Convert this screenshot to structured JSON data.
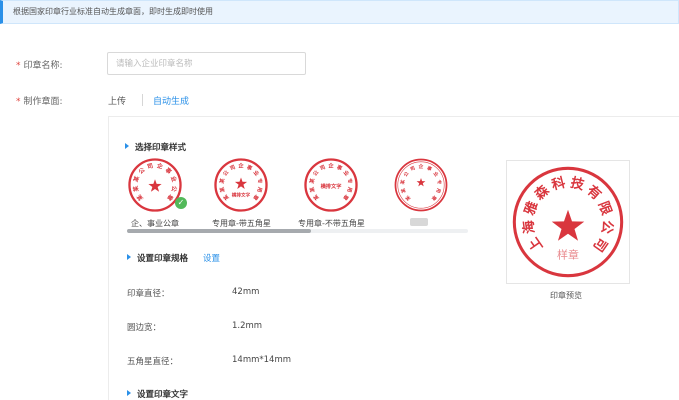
{
  "notice": {
    "text": "根据国家印章行业标准自动生成章面，即时生成即时使用"
  },
  "form": {
    "name_label": "印章名称:",
    "name_placeholder": "请输入企业印章名称",
    "make_label": "制作章面:",
    "required_mark": "*"
  },
  "mode_tabs": {
    "upload": "上传",
    "auto": "自动生成",
    "active": "auto"
  },
  "style_section": {
    "title": "选择印章样式",
    "styles": [
      {
        "label": "企、事业公章",
        "seal_text": "某某某公司企事业公章",
        "center_text": "",
        "selected": true
      },
      {
        "label": "专用章-带五角星",
        "seal_text": "某某某公司企事业专用章",
        "center_text": "横排文字",
        "selected": false
      },
      {
        "label": "专用章-不带五角星",
        "seal_text": "某某某公司企事业专用章",
        "center_text": "横排文字",
        "selected": false
      },
      {
        "label": "",
        "seal_text": "某某某公司企事业专用章",
        "center_text": "",
        "selected": false
      }
    ]
  },
  "spec_section": {
    "title": "设置印章规格",
    "settings_link": "设置",
    "rows": [
      {
        "label": "印章直径：",
        "value": "42mm"
      },
      {
        "label": "圆边宽：",
        "value": "1.2mm"
      },
      {
        "label": "五角星直径：",
        "value": "14mm*14mm"
      }
    ]
  },
  "text_section": {
    "title": "设置印章文字"
  },
  "preview": {
    "label": "印章预览",
    "seal_text": "上海雅森科技有限公司",
    "bottom_text": "样章"
  },
  "colors": {
    "accent": "#2a90e8",
    "seal_red": "#d9363e",
    "success": "#52b95a"
  }
}
